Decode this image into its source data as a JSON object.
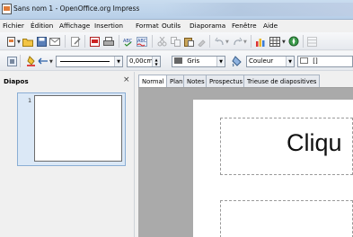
{
  "window": {
    "title": "Sans nom 1 - OpenOffice.org Impress"
  },
  "menu": [
    "Fichier",
    "Édition",
    "Affichage",
    "Insertion",
    "Format",
    "Outils",
    "Diaporama",
    "Fenêtre",
    "Aide"
  ],
  "line_toolbar": {
    "width_value": "0,00cm",
    "line_color": "Gris",
    "fill_mode": "Couleur",
    "fill_value": "[]"
  },
  "slide_pane": {
    "title": "Diapos",
    "close": "×",
    "slide_number": "1"
  },
  "view_tabs": [
    "Normal",
    "Plan",
    "Notes",
    "Prospectus",
    "Trieuse de diapositives"
  ],
  "slide": {
    "title_placeholder": "Cliqu"
  }
}
